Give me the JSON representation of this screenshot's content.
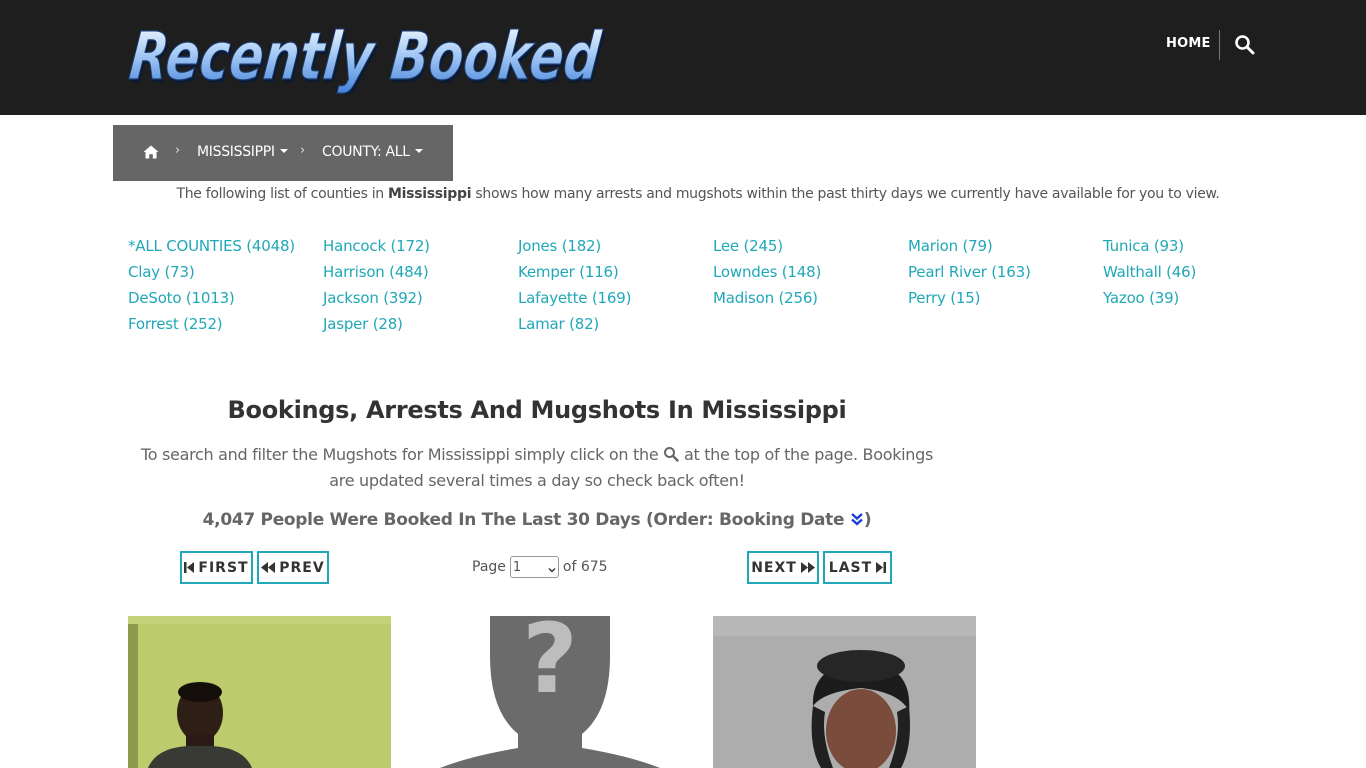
{
  "header": {
    "logo_text": "Recently Booked",
    "nav_home": "HOME",
    "search_icon": "search-icon"
  },
  "breadcrumb": {
    "home_icon": "home-icon",
    "state": "MISSISSIPPI",
    "county": "COUNTY: ALL"
  },
  "intro": {
    "before": "The following list of counties in ",
    "state": "Mississippi",
    "after": " shows how many arrests and mugshots within the past thirty days we currently have available for you to view."
  },
  "counties": [
    [
      "*ALL COUNTIES (4048)",
      "Clay (73)",
      "DeSoto (1013)",
      "Forrest (252)"
    ],
    [
      "Hancock (172)",
      "Harrison (484)",
      "Jackson (392)",
      "Jasper (28)"
    ],
    [
      "Jones (182)",
      "Kemper (116)",
      "Lafayette (169)",
      "Lamar (82)"
    ],
    [
      "Lee (245)",
      "Lowndes (148)",
      "Madison (256)"
    ],
    [
      "Marion (79)",
      "Pearl River (163)",
      "Perry (15)"
    ],
    [
      "Tunica (93)",
      "Walthall (46)",
      "Yazoo (39)"
    ]
  ],
  "main": {
    "title": "Bookings, Arrests And Mugshots In Mississippi",
    "desc_before": "To search and filter the Mugshots for Mississippi simply click on the ",
    "desc_after": " at the top of the page. Bookings are updated several times a day so check back often!",
    "count_text": "4,047 People Were Booked In The Last 30 Days (Order: Booking Date ",
    "count_close": ")"
  },
  "pagination": {
    "first": "FIRST",
    "prev": "PREV",
    "next": "NEXT",
    "last": "LAST",
    "page_label": "Page",
    "current_page": "1",
    "of_label": "of 675"
  },
  "colors": {
    "header_bg": "#1e1e1e",
    "accent": "#20a8b8",
    "breadcrumb_bg": "#666666"
  }
}
